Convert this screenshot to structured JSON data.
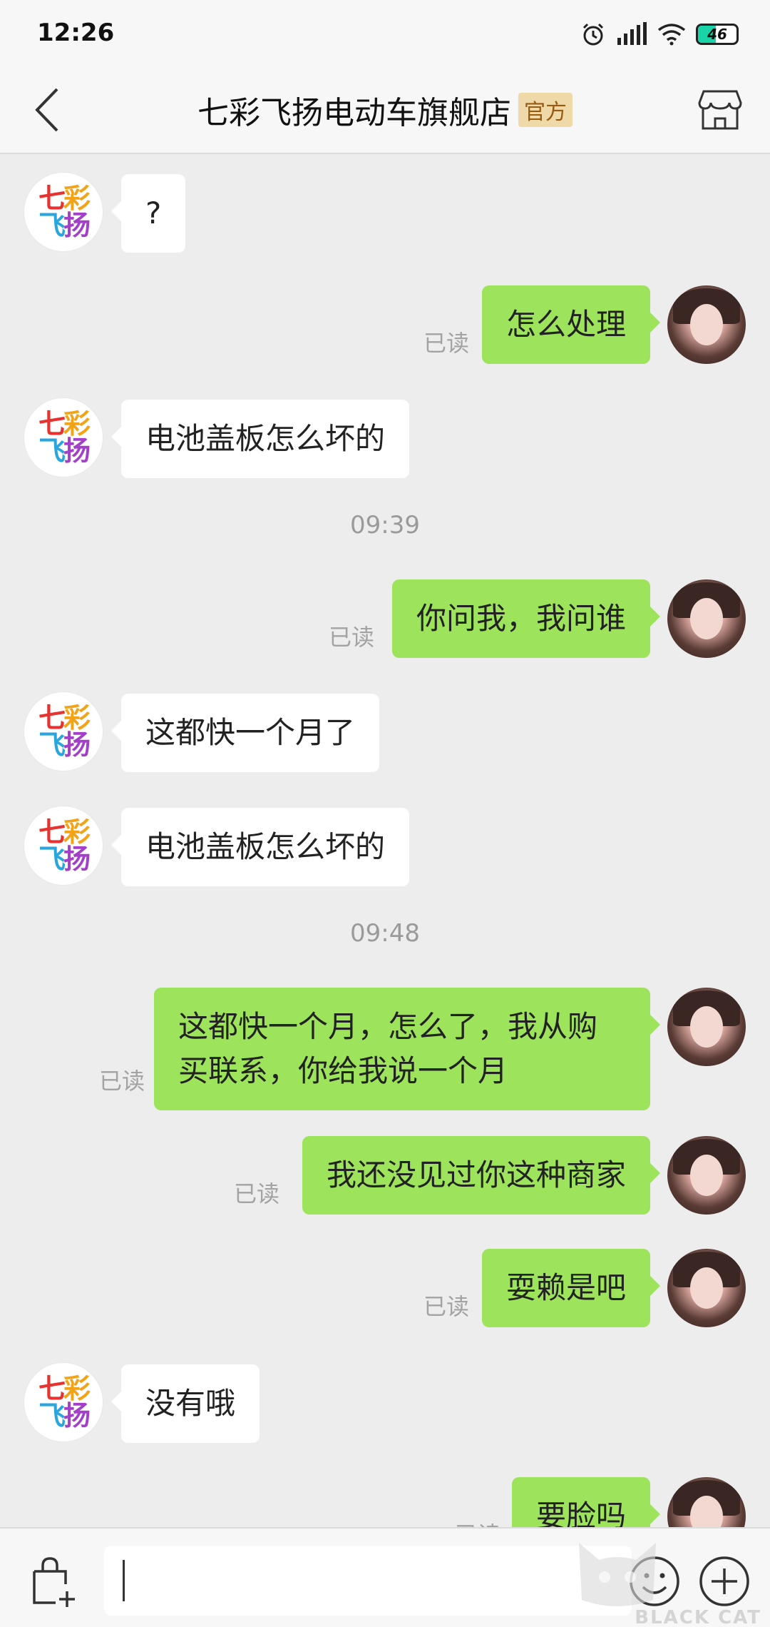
{
  "status_bar": {
    "time": "12:26",
    "battery": "46"
  },
  "header": {
    "title": "七彩飞扬电动车旗舰店",
    "badge": "官方"
  },
  "shop_logo": {
    "line1": "七彩",
    "line2": "飞扬"
  },
  "messages": [
    {
      "text": "?"
    },
    {
      "text": "怎么处理",
      "status": "已读"
    },
    {
      "text": "电池盖板怎么坏的"
    },
    {
      "text": "你问我，我问谁",
      "status": "已读"
    },
    {
      "text": "这都快一个月了"
    },
    {
      "text": "电池盖板怎么坏的"
    },
    {
      "text": "这都快一个月，怎么了，我从购\n买联系，你给我说一个月",
      "status": "已读"
    },
    {
      "text": "我还没见过你这种商家",
      "status": "已读"
    },
    {
      "text": "耍赖是吧",
      "status": "已读"
    },
    {
      "text": "没有哦"
    },
    {
      "text": "要脸吗",
      "status": "已读"
    }
  ],
  "timestamps": [
    "09:39",
    "09:48"
  ],
  "input": {
    "value": ""
  },
  "watermark": {
    "text": "BLACK CAT"
  },
  "colors": {
    "bubble_sent": "#9de35c",
    "bubble_received": "#ffffff",
    "background": "#ededed",
    "badge_bg": "#f0d9a8",
    "battery": "#19d4a7"
  }
}
